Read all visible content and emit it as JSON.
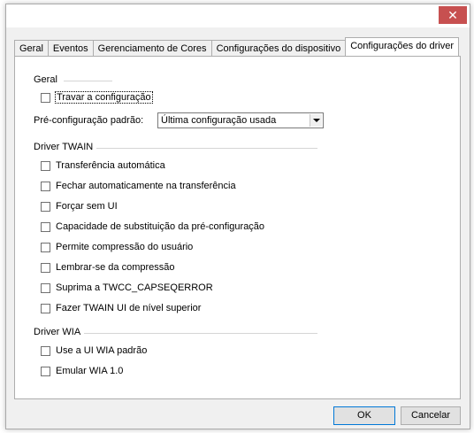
{
  "window": {
    "close_symbol": "✕"
  },
  "tabs": [
    {
      "label": "Geral",
      "active": false
    },
    {
      "label": "Eventos",
      "active": false
    },
    {
      "label": "Gerenciamento de Cores",
      "active": false
    },
    {
      "label": "Configurações do dispositivo",
      "active": false
    },
    {
      "label": "Configurações do driver",
      "active": true
    }
  ],
  "general": {
    "title": "Geral",
    "lock_config": {
      "label": "Travar a configuração",
      "checked": false
    },
    "preset_label": "Pré-configuração padrão:",
    "preset_value": "Última configuração usada"
  },
  "twain": {
    "title": "Driver TWAIN",
    "options": [
      {
        "label": "Transferência automática",
        "checked": false
      },
      {
        "label": "Fechar automaticamente na transferência",
        "checked": false
      },
      {
        "label": "Forçar sem UI",
        "checked": false
      },
      {
        "label": "Capacidade de substituição da pré-configuração",
        "checked": false
      },
      {
        "label": "Permite compressão do usuário",
        "checked": false
      },
      {
        "label": "Lembrar-se da compressão",
        "checked": false
      },
      {
        "label": "Suprima a TWCC_CAPSEQERROR",
        "checked": false
      },
      {
        "label": "Fazer TWAIN UI de nível superior",
        "checked": false
      }
    ]
  },
  "wia": {
    "title": "Driver WIA",
    "options": [
      {
        "label": "Use a UI WIA padrão",
        "checked": false
      },
      {
        "label": "Emular WIA 1.0",
        "checked": false
      }
    ]
  },
  "buttons": {
    "ok": "OK",
    "cancel": "Cancelar"
  }
}
